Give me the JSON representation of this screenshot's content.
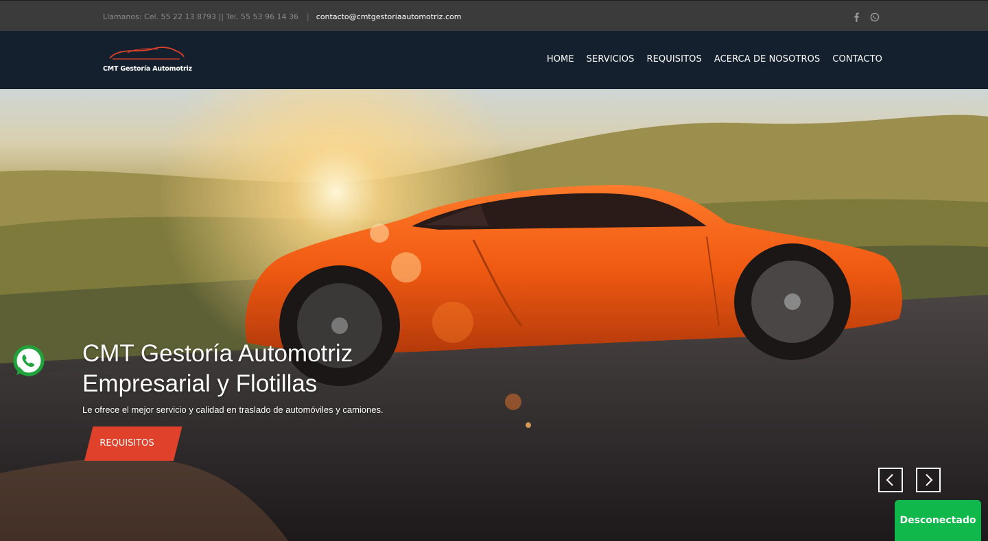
{
  "topbar": {
    "phone_text": "Llamanos: Cel. 55 22 13 8793 || Tel. 55 53 96 14 36",
    "separator": "|",
    "email": "contacto@cmtgestoriaautomotriz.com",
    "social": [
      "facebook-icon",
      "whatsapp-icon"
    ]
  },
  "header": {
    "logo_text": "CMT Gestoría Automotriz",
    "nav": [
      "HOME",
      "SERVICIOS",
      "REQUISITOS",
      "ACERCA DE NOSOTROS",
      "CONTACTO"
    ]
  },
  "hero": {
    "title_line1": "CMT Gestoría Automotriz",
    "title_line2": "Empresarial y Flotillas",
    "subtitle": "Le ofrece el mejor servicio y calidad en traslado de automóviles y camiones.",
    "cta": "REQUISITOS",
    "prev_icon": "chevron-left-icon",
    "next_icon": "chevron-right-icon"
  },
  "floating": {
    "whatsapp_icon": "whatsapp-icon",
    "chat_status": "Desconectado"
  },
  "colors": {
    "topbar": "#3b3b3b",
    "header": "#15202f",
    "accent": "#e0412b",
    "status": "#10b74a"
  }
}
